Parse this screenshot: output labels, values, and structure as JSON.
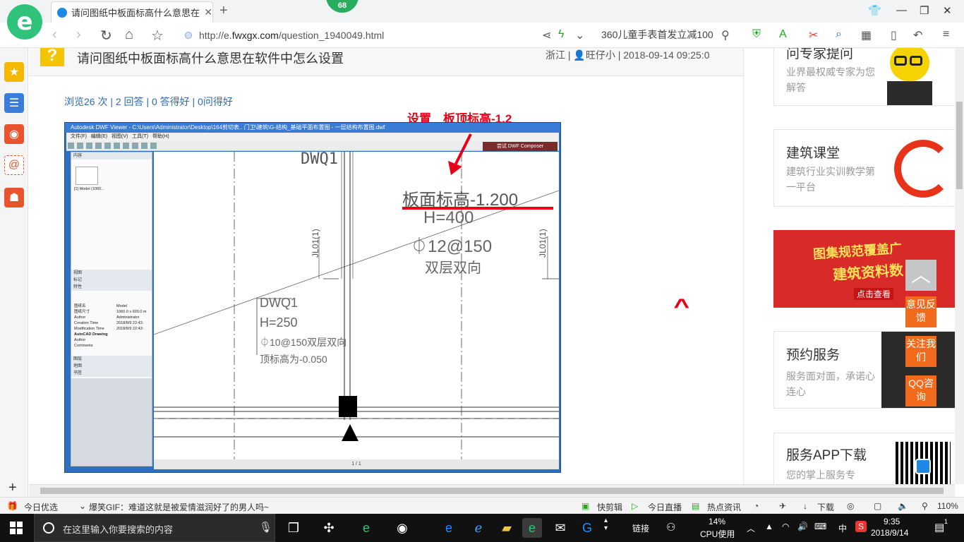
{
  "browser": {
    "tab_title": "请问图纸中板面标高什么意思在软",
    "badge_count": "68",
    "url_prefix": "http://e.",
    "url_domain": "fwxgx.com",
    "url_path": "/question_1940049.html",
    "search_text": "360儿童手表首发立减100"
  },
  "question": {
    "title": "请问图纸中板面标高什么意思在软件中怎么设置",
    "meta": "浙江 | 👤旺仔小 | 2018-09-14 09:25:0",
    "stats": "浏览26 次 | 2 回答 | 0 答得好 | 0问得好",
    "annotation": "设置　板顶标高-1.2",
    "caret": "^"
  },
  "embedded": {
    "window_title": "Autodesk DWF Viewer - C:\\Users\\Administrator\\Desktop\\164剪切表.. 门卫\\建筑\\G-结构_基础平面布置图 - 一层结构布置图.dwf",
    "menu": [
      "文件(F)",
      "编辑(E)",
      "视图(V)",
      "工具(T)",
      "帮助(H)"
    ],
    "composer_label": "尝试 DWF Composer",
    "panel_sections": [
      "内容",
      "视图",
      "标记",
      "特性",
      "图层",
      "地图",
      "书签"
    ],
    "thumb_label": "[1] Model (1060...",
    "props": [
      [
        "图纸名",
        "Model"
      ],
      [
        "图纸尺寸",
        "1060.0 x 600.0 m"
      ],
      [
        "Author",
        "Administrator"
      ],
      [
        "Creation Time",
        "2018/8/9 22:43:"
      ],
      [
        "Modification Time",
        "2018/8/9 22:43:"
      ],
      [
        "AutoCAD Drawing",
        ""
      ],
      [
        "Author",
        ""
      ],
      [
        "Comments",
        ""
      ]
    ],
    "cad_text": {
      "dwq_top": "DWQ1",
      "elev": "板面标高-1.200",
      "h400": "H=400",
      "rebar150": "⏀12@150",
      "double": "双层双向",
      "dwq2": "DWQ1",
      "h250": "H=250",
      "rebar_bottom": "⏀10@150双层双向",
      "elev2": "顶标高为-0.050",
      "jl_left": "JL01(1)",
      "jl_right": "JL01(1)"
    },
    "page_indicator": "1 / 1"
  },
  "sidebar": {
    "expert_title": "问专家提问",
    "expert_sub": "业界最权威专家为您解答",
    "class_title": "建筑课堂",
    "class_sub": "建筑行业实训教学第一平台",
    "banner_line1": "图集规范覆盖广",
    "banner_line2": "建筑资料数",
    "banner_cta": "点击查看",
    "booking_title": "预约服务",
    "booking_sub": "服务面对面，承诺心连心",
    "app_title": "服务APP下载",
    "app_sub": "您的掌上服务专",
    "float_feedback": "意见反馈",
    "float_follow": "关注我们",
    "float_qq": "QQ咨询"
  },
  "statusbar": {
    "today": "今日优选",
    "news": "爆笑GIF：难道这就是被爱情滋润好了的男人吗~",
    "clip": "快剪辑",
    "live": "今日直播",
    "hot": "热点资讯",
    "download": "下载",
    "zoom": "110%"
  },
  "taskbar": {
    "search_placeholder": "在这里输入你要搜索的内容",
    "link_label": "链接",
    "cpu_percent": "14%",
    "cpu_label": "CPU使用",
    "ime": "中",
    "time": "9:35",
    "date": "2018/9/14",
    "notif_count": "1"
  },
  "colors": {
    "accent_red": "#e8001a",
    "link_blue": "#2a6cb0",
    "float_orange": "#f26b1d",
    "logo_green": "#2ec27a"
  }
}
